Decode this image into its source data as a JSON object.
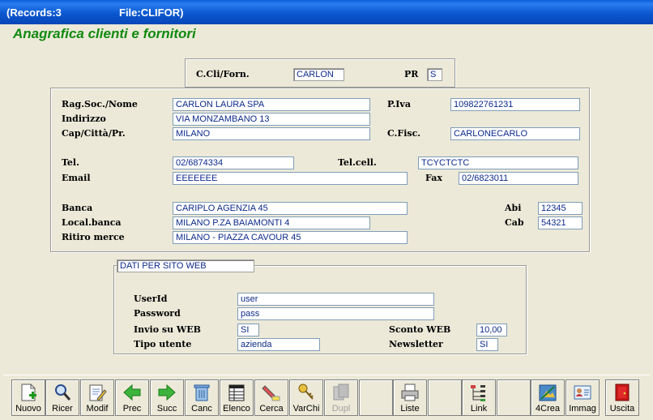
{
  "titlebar": {
    "records": "(Records:3",
    "file": "File:CLIFOR)"
  },
  "heading": "Anagrafica clienti e fornitori",
  "top": {
    "code_label": "C.Cli/Forn.",
    "code_value": "CARLON",
    "pr_label": "PR",
    "pr_value": "S"
  },
  "main": {
    "ragsoc_label": "Rag.Soc./Nome",
    "ragsoc_value": "CARLON LAURA SPA",
    "piva_label": "P.Iva",
    "piva_value": "109822761231",
    "indirizzo_label": "Indirizzo",
    "indirizzo_value": "VIA MONZAMBANO 13",
    "cap_label": "Cap/Città/Pr.",
    "cap_value": "MILANO",
    "cfisc_label": "C.Fisc.",
    "cfisc_value": "CARLONECARLO",
    "tel_label": "Tel.",
    "tel_value": "02/6874334",
    "telcell_label": "Tel.cell.",
    "telcell_value": "TCYCTCTC",
    "email_label": "Email",
    "email_value": "EEEEEEE",
    "fax_label": "Fax",
    "fax_value": "02/6823011",
    "banca_label": "Banca",
    "banca_value": "CARIPLO AGENZIA 45",
    "abi_label": "Abi",
    "abi_value": "12345",
    "localbanca_label": "Local.banca",
    "localbanca_value": "MILANO P.ZA BAIAMONTI 4",
    "cab_label": "Cab",
    "cab_value": "54321",
    "ritiro_label": "Ritiro merce",
    "ritiro_value": "MILANO - PIAZZA CAVOUR 45"
  },
  "web": {
    "title": "DATI PER SITO WEB",
    "userid_label": "UserId",
    "userid_value": "user",
    "password_label": "Password",
    "password_value": "pass",
    "invio_label": "Invio su WEB",
    "invio_value": "SI",
    "sconto_label": "Sconto WEB",
    "sconto_value": "10,00",
    "tipo_label": "Tipo utente",
    "tipo_value": "azienda",
    "newsletter_label": "Newsletter",
    "newsletter_value": "SI"
  },
  "toolbar": {
    "nuovo": "Nuovo",
    "ricer": "Ricer",
    "modif": "Modif",
    "prec": "Prec",
    "succ": "Succ",
    "canc": "Canc",
    "elenco": "Elenco",
    "cerca": "Cerca",
    "varchi": "VarChi",
    "dupl": "Dupl",
    "liste": "Liste",
    "link": "Link",
    "crea": "4Crea",
    "immag": "Immag",
    "uscita": "Uscita"
  },
  "colors": {
    "title_bar": "#0b58d0",
    "heading": "#108a10",
    "field_text": "#0c2a8c",
    "window_bg": "#ece9d8"
  }
}
